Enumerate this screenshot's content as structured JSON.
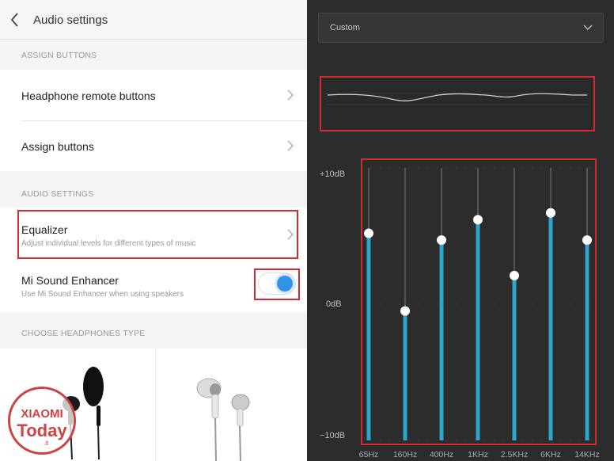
{
  "header": {
    "title": "Audio settings"
  },
  "sections": {
    "assign_buttons": "ASSIGN BUTTONS",
    "audio_settings": "AUDIO SETTINGS",
    "headphones_type": "CHOOSE HEADPHONES TYPE"
  },
  "rows": {
    "headphone_remote": "Headphone remote buttons",
    "assign_buttons": "Assign buttons",
    "equalizer": {
      "label": "Equalizer",
      "sub": "Adjust individual levels for different types of music"
    },
    "sound_enhancer": {
      "label": "Mi Sound Enhancer",
      "sub": "Use Mi Sound Enhancer when using speakers",
      "enabled": true
    }
  },
  "equalizer": {
    "preset": "Custom",
    "db_max": "+10dB",
    "db_mid": "0dB",
    "db_min": "−10dB",
    "range_db": [
      -10,
      10
    ],
    "bands": [
      {
        "freq": "65Hz",
        "gain_db": 5.2
      },
      {
        "freq": "160Hz",
        "gain_db": -0.5
      },
      {
        "freq": "400Hz",
        "gain_db": 4.7
      },
      {
        "freq": "1KHz",
        "gain_db": 6.2
      },
      {
        "freq": "2.5KHz",
        "gain_db": 2.1
      },
      {
        "freq": "6KHz",
        "gain_db": 6.7
      },
      {
        "freq": "14KHz",
        "gain_db": 4.7
      }
    ]
  },
  "watermark": {
    "line1": "XIAOMI",
    "line2": "Today",
    "line3": ".it"
  },
  "colors": {
    "accent": "#3193e8",
    "eq_bar": "#2aa6cf",
    "highlight": "#d42b31"
  }
}
